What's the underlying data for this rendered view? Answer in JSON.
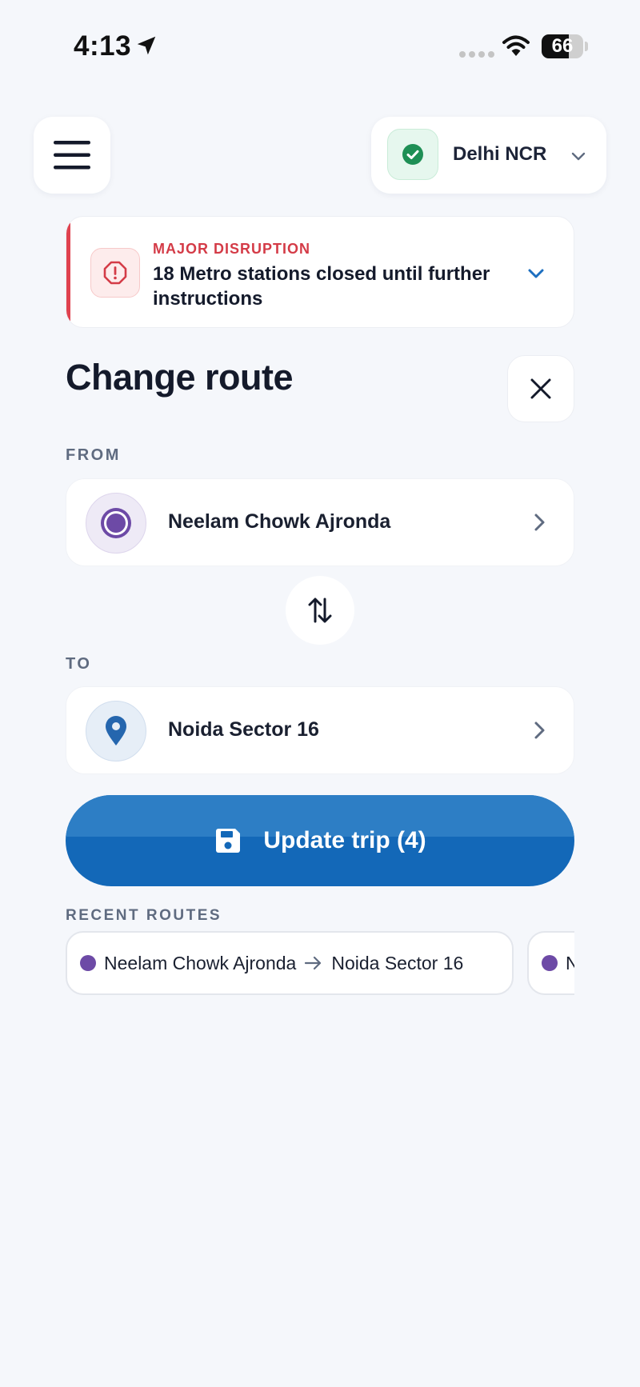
{
  "status_bar": {
    "time": "4:13",
    "battery": "66",
    "icons": [
      "location-arrow-icon",
      "signal-icon",
      "wifi-icon",
      "battery-icon"
    ]
  },
  "header": {
    "menu_icon": "hamburger-menu-icon",
    "region": {
      "label": "Delhi NCR",
      "status_icon": "check-circle-icon",
      "status_color": "#1e8f55"
    }
  },
  "alert": {
    "eyebrow": "MAJOR DISRUPTION",
    "message": "18 Metro stations closed until further instructions",
    "accent_color": "#e0424f",
    "icon": "alert-octagon-icon"
  },
  "page": {
    "title": "Change route",
    "close_icon": "close-icon"
  },
  "route": {
    "from": {
      "section_label": "FROM",
      "station": "Neelam Chowk Ajronda",
      "icon": "origin-circle-icon",
      "color": "#6d4aa6"
    },
    "swap_icon": "swap-vertical-icon",
    "to": {
      "section_label": "TO",
      "station": "Noida Sector 16",
      "icon": "map-pin-icon",
      "color": "#2566ae"
    }
  },
  "update_button": {
    "label": "Update trip (4)",
    "icon": "save-icon",
    "color": "#1368b8"
  },
  "recent_routes": {
    "section_label": "RECENT ROUTES",
    "items": [
      {
        "from": "Neelam Chowk Ajronda",
        "to": "Noida Sector 16"
      },
      {
        "from": "N",
        "to": ""
      }
    ]
  }
}
